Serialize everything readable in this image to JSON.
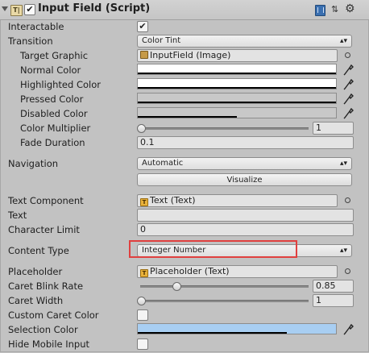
{
  "component": {
    "title": "Input Field (Script)",
    "icon": "component-icon",
    "enabled": true
  },
  "header_icons": [
    "help-book-icon",
    "presets-icon",
    "gear-icon"
  ],
  "properties": {
    "interactable": {
      "label": "Interactable",
      "checked": true
    },
    "transition": {
      "label": "Transition",
      "value": "Color Tint"
    },
    "target_graphic": {
      "label": "Target Graphic",
      "value": "InputField (Image)",
      "icon": "image-icon"
    },
    "normal_color": {
      "label": "Normal Color",
      "color": "#ffffff",
      "alpha": 1.0
    },
    "highlighted_color": {
      "label": "Highlighted Color",
      "color": "#ffffff",
      "alpha": 1.0
    },
    "pressed_color": {
      "label": "Pressed Color",
      "color": "#c8c8c8",
      "alpha": 1.0
    },
    "disabled_color": {
      "label": "Disabled Color",
      "color": "#c8c8c8",
      "alpha": 0.5
    },
    "color_multiplier": {
      "label": "Color Multiplier",
      "value": "1",
      "fraction": 0.0
    },
    "fade_duration": {
      "label": "Fade Duration",
      "value": "0.1"
    },
    "navigation": {
      "label": "Navigation",
      "value": "Automatic",
      "visualize": "Visualize"
    },
    "text_component": {
      "label": "Text Component",
      "value": "Text (Text)",
      "icon": "text-icon"
    },
    "text": {
      "label": "Text",
      "value": ""
    },
    "character_limit": {
      "label": "Character Limit",
      "value": "0"
    },
    "content_type": {
      "label": "Content Type",
      "value": "Integer Number"
    },
    "placeholder": {
      "label": "Placeholder",
      "value": "Placeholder (Text)",
      "icon": "text-icon"
    },
    "caret_blink_rate": {
      "label": "Caret Blink Rate",
      "value": "0.85",
      "fraction": 0.2125
    },
    "caret_width": {
      "label": "Caret Width",
      "value": "1",
      "fraction": 0.0
    },
    "custom_caret_color": {
      "label": "Custom Caret Color",
      "checked": false
    },
    "selection_color": {
      "label": "Selection Color",
      "color": "#a8cef2",
      "alpha": 0.75
    },
    "hide_mobile_input": {
      "label": "Hide Mobile Input",
      "checked": false
    }
  },
  "colors": {
    "highlight_border": "#e0403f",
    "panel_bg": "#c2c2c2"
  }
}
